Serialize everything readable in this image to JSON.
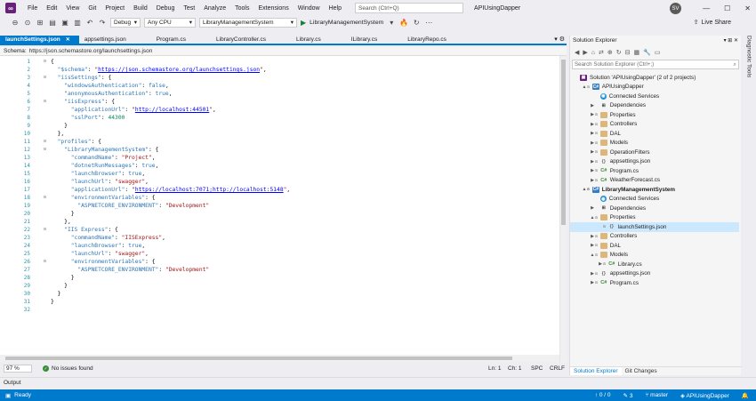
{
  "menu": {
    "items": [
      "File",
      "Edit",
      "View",
      "Git",
      "Project",
      "Build",
      "Debug",
      "Test",
      "Analyze",
      "Tools",
      "Extensions",
      "Window",
      "Help"
    ],
    "search_placeholder": "Search (Ctrl+Q)",
    "app_title": "APIUsingDapper",
    "avatar_initials": "SV"
  },
  "toolbar": {
    "config": "Debug",
    "platform": "Any CPU",
    "startup_project": "LibraryManagementSystem",
    "run_label": "LibraryManagementSystem",
    "live_share": "Live Share"
  },
  "tabs": [
    {
      "label": "launchSettings.json",
      "active": true
    },
    {
      "label": "appsettings.json",
      "active": false
    },
    {
      "label": "Program.cs",
      "active": false
    },
    {
      "label": "LibraryController.cs",
      "active": false
    },
    {
      "label": "Library.cs",
      "active": false
    },
    {
      "label": "ILibrary.cs",
      "active": false
    },
    {
      "label": "LibraryRepo.cs",
      "active": false
    }
  ],
  "schema": {
    "label": "Schema:",
    "value": "https://json.schemastore.org/launchsettings.json"
  },
  "code": {
    "line_numbers": [
      "1",
      "2",
      "3",
      "4",
      "5",
      "6",
      "7",
      "8",
      "9",
      "10",
      "11",
      "12",
      "13",
      "14",
      "15",
      "16",
      "17",
      "18",
      "19",
      "20",
      "21",
      "22",
      "23",
      "24",
      "25",
      "26",
      "27",
      "28",
      "29",
      "30",
      "31",
      "32"
    ],
    "lines": [
      "{",
      "  \"$schema\": \"https://json.schemastore.org/launchsettings.json\",",
      "  \"iisSettings\": {",
      "    \"windowsAuthentication\": false,",
      "    \"anonymousAuthentication\": true,",
      "    \"iisExpress\": {",
      "      \"applicationUrl\": \"http://localhost:44501\",",
      "      \"sslPort\": 44300",
      "    }",
      "  },",
      "  \"profiles\": {",
      "    \"LibraryManagementSystem\": {",
      "      \"commandName\": \"Project\",",
      "      \"dotnetRunMessages\": true,",
      "      \"launchBrowser\": true,",
      "      \"launchUrl\": \"swagger\",",
      "      \"applicationUrl\": \"https://localhost:7071;http://localhost:5148\",",
      "      \"environmentVariables\": {",
      "        \"ASPNETCORE_ENVIRONMENT\": \"Development\"",
      "      }",
      "    },",
      "    \"IIS Express\": {",
      "      \"commandName\": \"IISExpress\",",
      "      \"launchBrowser\": true,",
      "      \"launchUrl\": \"swagger\",",
      "      \"environmentVariables\": {",
      "        \"ASPNETCORE_ENVIRONMENT\": \"Development\"",
      "      }",
      "    }",
      "  }",
      "}",
      ""
    ]
  },
  "editor_status": {
    "zoom": "97 %",
    "issues": "No issues found",
    "line": "Ln: 1",
    "col": "Ch: 1",
    "spc": "SPC",
    "eol": "CRLF"
  },
  "output": {
    "label": "Output"
  },
  "statusbar": {
    "ready": "Ready",
    "changes": "0 / 0",
    "commits": "3",
    "branch": "master",
    "repo": "APIUsingDapper"
  },
  "solution_explorer": {
    "title": "Solution Explorer",
    "search_placeholder": "Search Solution Explorer (Ctrl+;)",
    "tabs": [
      "Solution Explorer",
      "Git Changes"
    ],
    "tree": [
      {
        "label": "Solution 'APIUsingDapper' (2 of 2 projects)",
        "icon": "sln",
        "indent": 0,
        "arrow": "",
        "bold": false
      },
      {
        "label": "APIUsingDapper",
        "icon": "proj",
        "indent": 1,
        "arrow": "▲",
        "bold": false
      },
      {
        "label": "Connected Services",
        "icon": "svc",
        "indent": 2,
        "arrow": "",
        "bold": false
      },
      {
        "label": "Dependencies",
        "icon": "dep",
        "indent": 2,
        "arrow": "▶",
        "bold": false
      },
      {
        "label": "Properties",
        "icon": "folder",
        "indent": 2,
        "arrow": "▶",
        "bold": false
      },
      {
        "label": "Controllers",
        "icon": "folder",
        "indent": 2,
        "arrow": "▶",
        "bold": false
      },
      {
        "label": "DAL",
        "icon": "folder",
        "indent": 2,
        "arrow": "▶",
        "bold": false
      },
      {
        "label": "Models",
        "icon": "folder",
        "indent": 2,
        "arrow": "▶",
        "bold": false
      },
      {
        "label": "OperationFilters",
        "icon": "folder",
        "indent": 2,
        "arrow": "▶",
        "bold": false
      },
      {
        "label": "appsettings.json",
        "icon": "json",
        "indent": 2,
        "arrow": "▶",
        "bold": false
      },
      {
        "label": "Program.cs",
        "icon": "cs",
        "indent": 2,
        "arrow": "▶",
        "bold": false
      },
      {
        "label": "WeatherForecast.cs",
        "icon": "cs",
        "indent": 2,
        "arrow": "▶",
        "bold": false
      },
      {
        "label": "LibraryManagementSystem",
        "icon": "proj",
        "indent": 1,
        "arrow": "▲",
        "bold": true
      },
      {
        "label": "Connected Services",
        "icon": "svc",
        "indent": 2,
        "arrow": "",
        "bold": false
      },
      {
        "label": "Dependencies",
        "icon": "dep",
        "indent": 2,
        "arrow": "▶",
        "bold": false
      },
      {
        "label": "Properties",
        "icon": "folder",
        "indent": 2,
        "arrow": "▲",
        "bold": false
      },
      {
        "label": "launchSettings.json",
        "icon": "json",
        "indent": 3,
        "arrow": "",
        "bold": false,
        "selected": true
      },
      {
        "label": "Controllers",
        "icon": "folder",
        "indent": 2,
        "arrow": "▶",
        "bold": false
      },
      {
        "label": "DAL",
        "icon": "folder",
        "indent": 2,
        "arrow": "▶",
        "bold": false
      },
      {
        "label": "Models",
        "icon": "folder",
        "indent": 2,
        "arrow": "▲",
        "bold": false
      },
      {
        "label": "Library.cs",
        "icon": "cs",
        "indent": 3,
        "arrow": "▶",
        "bold": false
      },
      {
        "label": "appsettings.json",
        "icon": "json",
        "indent": 2,
        "arrow": "▶",
        "bold": false
      },
      {
        "label": "Program.cs",
        "icon": "cs",
        "indent": 2,
        "arrow": "▶",
        "bold": false
      }
    ]
  },
  "diagnostic_tools": "Diagnostic Tools",
  "colors": {
    "accent": "#007acc",
    "selection": "#cce8ff",
    "vs_purple": "#68217a"
  }
}
